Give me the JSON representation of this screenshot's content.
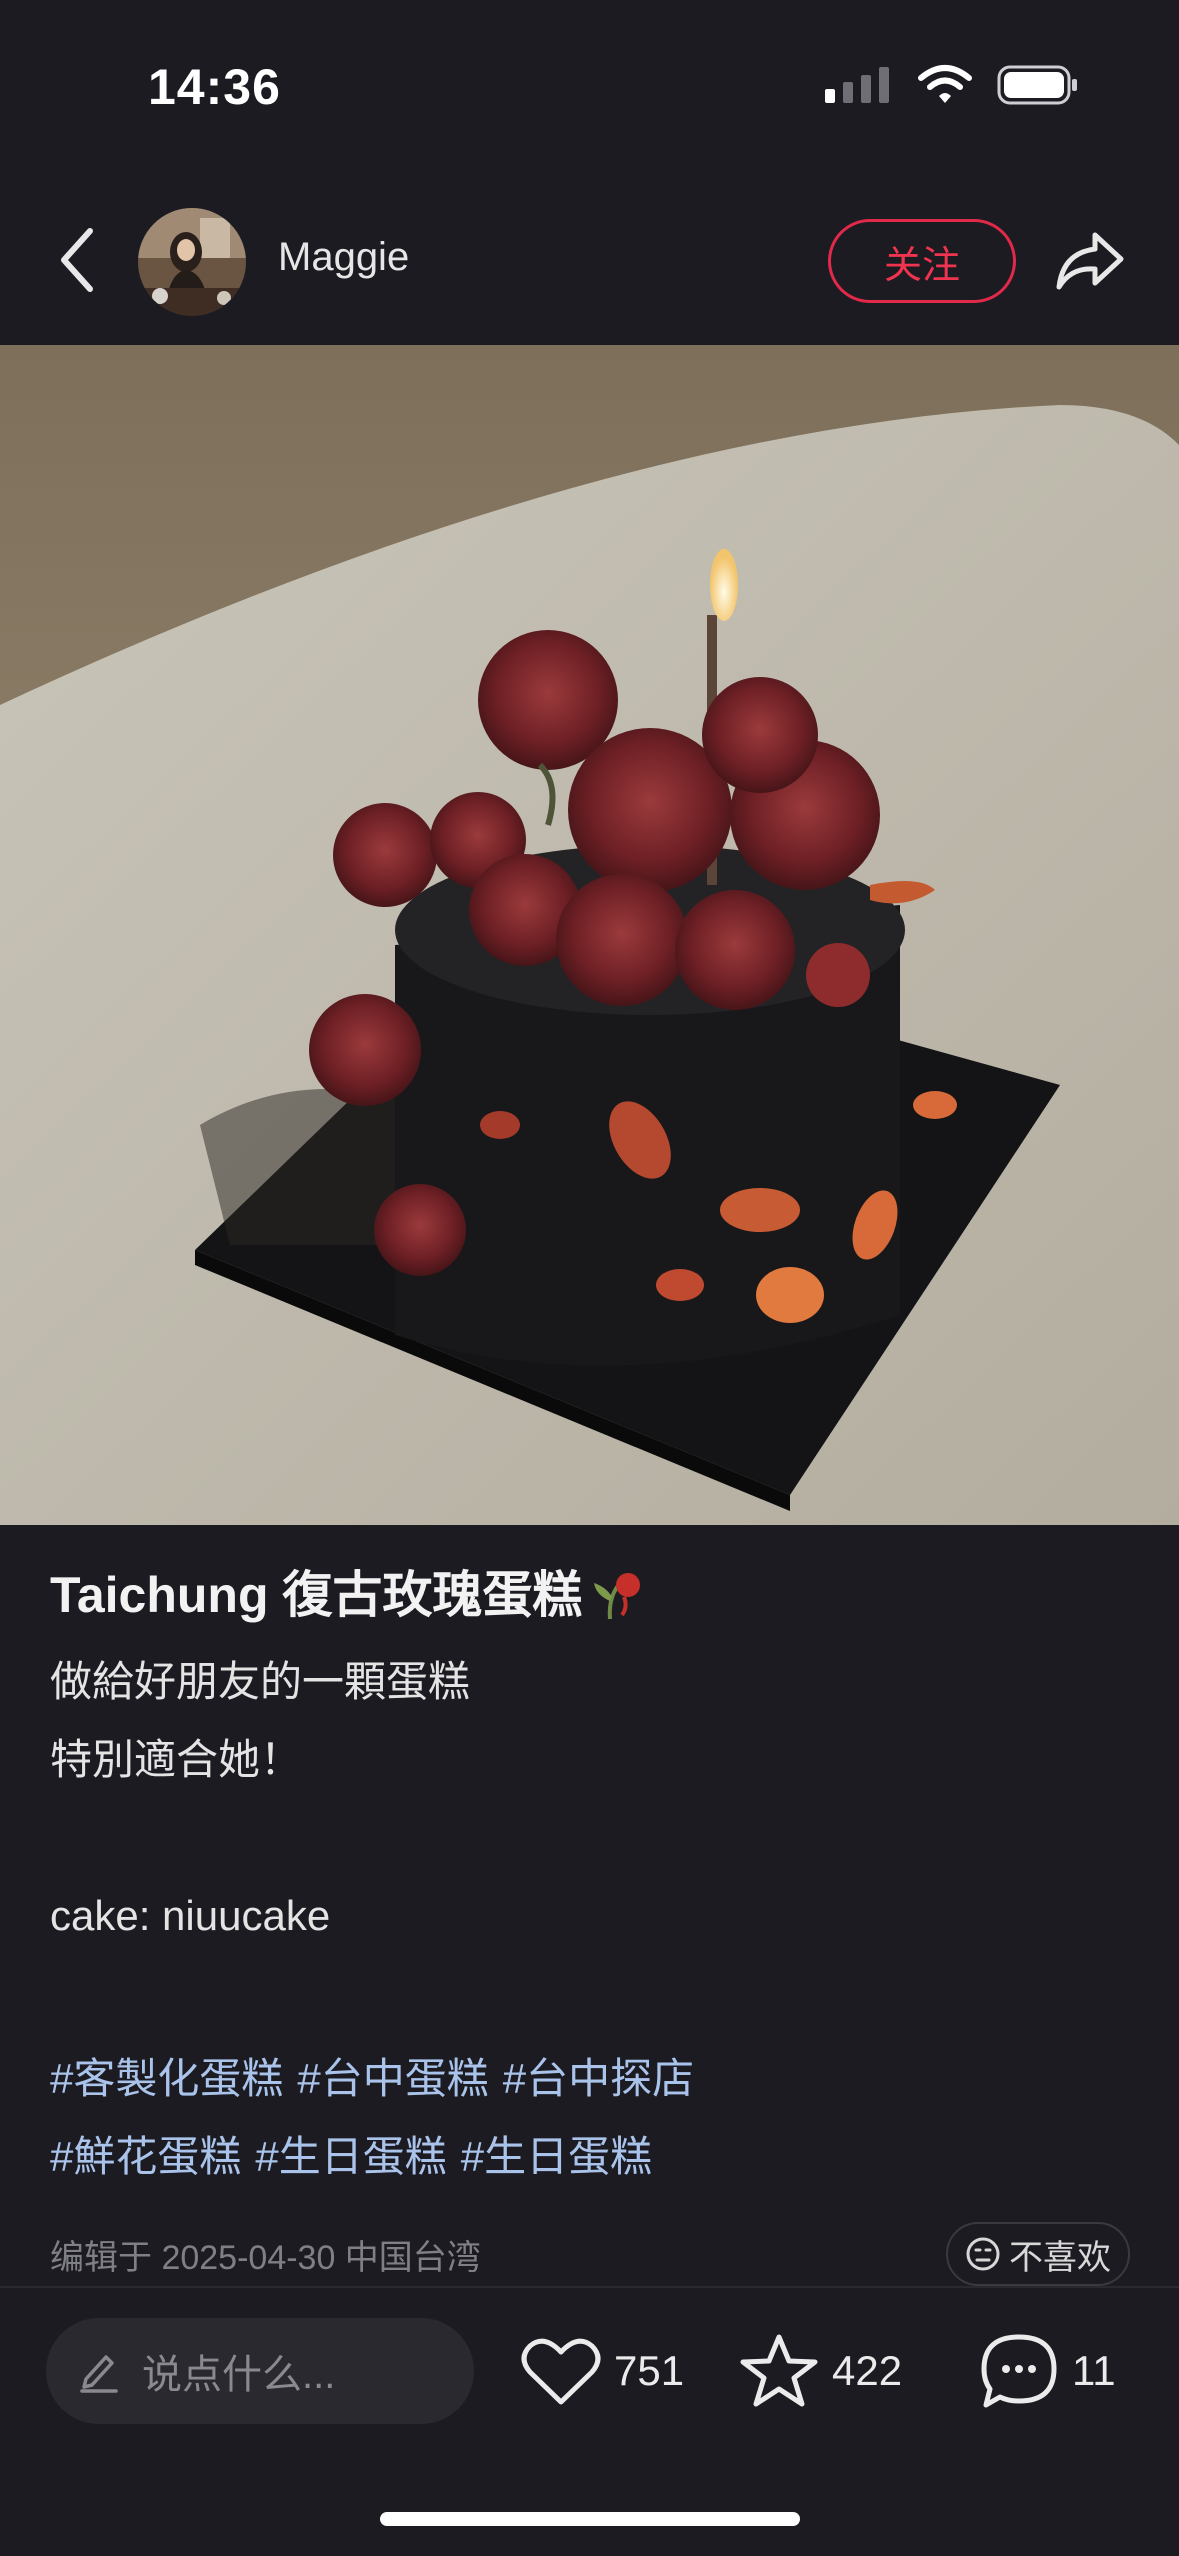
{
  "status_bar": {
    "time": "14:36"
  },
  "header": {
    "username": "Maggie",
    "follow_label": "关注"
  },
  "post": {
    "title": "Taichung 復古玫瑰蛋糕",
    "lines": [
      "做給好朋友的一顆蛋糕",
      "特別適合她！",
      "",
      "cake: niuucake"
    ],
    "tags_line1": [
      "#客製化蛋糕",
      "#台中蛋糕",
      "#台中探店"
    ],
    "tags_line2": [
      "#鮮花蛋糕",
      "#生日蛋糕",
      "#生日蛋糕"
    ],
    "meta": "编辑于 2025-04-30 中国台湾",
    "dislike_label": "不喜欢"
  },
  "bottom_bar": {
    "comment_placeholder": "说点什么...",
    "likes": "751",
    "favorites": "422",
    "comments": "11"
  },
  "colors": {
    "accent": "#e1294a",
    "tag": "#a9c3ea",
    "background": "#1c1b22"
  }
}
